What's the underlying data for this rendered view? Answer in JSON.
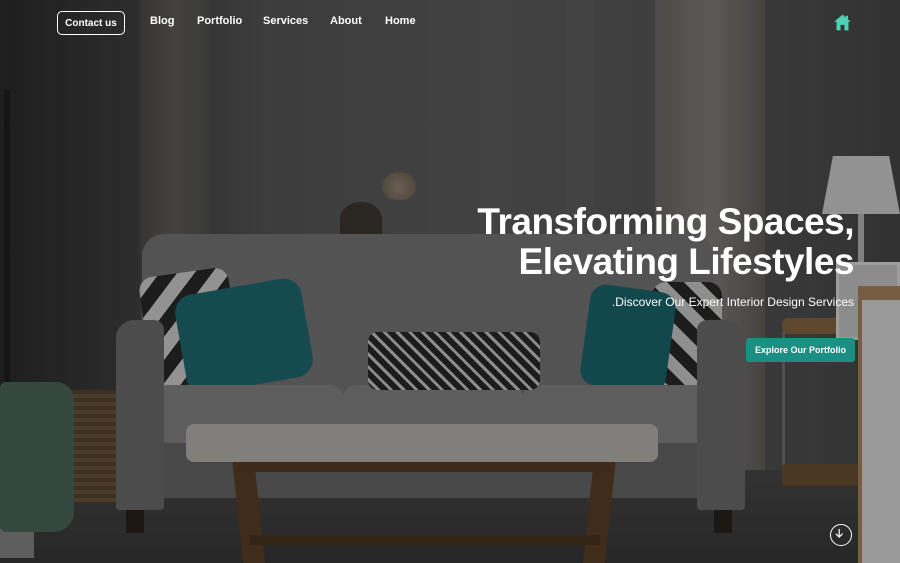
{
  "nav": {
    "contact_label": "Contact us",
    "links": [
      "Blog",
      "Portfolio",
      "Services",
      "About",
      "Home"
    ],
    "home_icon": "home-icon",
    "accent_color": "#4fd1b5"
  },
  "hero": {
    "title_line1": "Transforming Spaces,",
    "title_line2": "Elevating Lifestyles",
    "subtitle": ".Discover Our Expert Interior Design Services",
    "cta_label": "Explore Our Portfolio",
    "cta_color": "#1a8f82"
  },
  "scroll_icon": "arrow-down-circle-icon"
}
